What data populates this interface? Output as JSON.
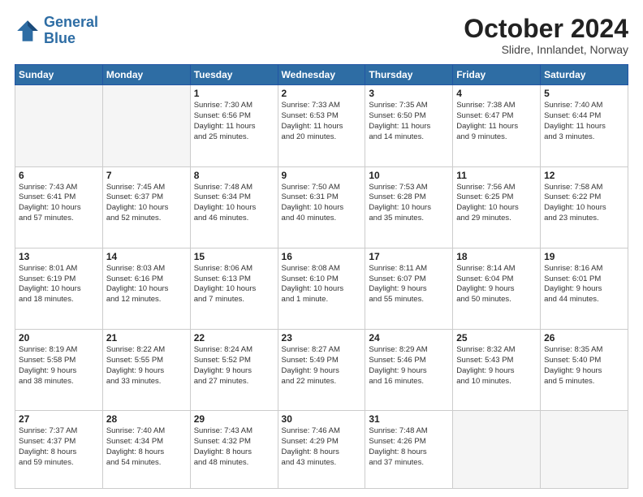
{
  "logo": {
    "line1": "General",
    "line2": "Blue"
  },
  "title": "October 2024",
  "subtitle": "Slidre, Innlandet, Norway",
  "headers": [
    "Sunday",
    "Monday",
    "Tuesday",
    "Wednesday",
    "Thursday",
    "Friday",
    "Saturday"
  ],
  "weeks": [
    [
      {
        "day": "",
        "detail": ""
      },
      {
        "day": "",
        "detail": ""
      },
      {
        "day": "1",
        "detail": "Sunrise: 7:30 AM\nSunset: 6:56 PM\nDaylight: 11 hours\nand 25 minutes."
      },
      {
        "day": "2",
        "detail": "Sunrise: 7:33 AM\nSunset: 6:53 PM\nDaylight: 11 hours\nand 20 minutes."
      },
      {
        "day": "3",
        "detail": "Sunrise: 7:35 AM\nSunset: 6:50 PM\nDaylight: 11 hours\nand 14 minutes."
      },
      {
        "day": "4",
        "detail": "Sunrise: 7:38 AM\nSunset: 6:47 PM\nDaylight: 11 hours\nand 9 minutes."
      },
      {
        "day": "5",
        "detail": "Sunrise: 7:40 AM\nSunset: 6:44 PM\nDaylight: 11 hours\nand 3 minutes."
      }
    ],
    [
      {
        "day": "6",
        "detail": "Sunrise: 7:43 AM\nSunset: 6:41 PM\nDaylight: 10 hours\nand 57 minutes."
      },
      {
        "day": "7",
        "detail": "Sunrise: 7:45 AM\nSunset: 6:37 PM\nDaylight: 10 hours\nand 52 minutes."
      },
      {
        "day": "8",
        "detail": "Sunrise: 7:48 AM\nSunset: 6:34 PM\nDaylight: 10 hours\nand 46 minutes."
      },
      {
        "day": "9",
        "detail": "Sunrise: 7:50 AM\nSunset: 6:31 PM\nDaylight: 10 hours\nand 40 minutes."
      },
      {
        "day": "10",
        "detail": "Sunrise: 7:53 AM\nSunset: 6:28 PM\nDaylight: 10 hours\nand 35 minutes."
      },
      {
        "day": "11",
        "detail": "Sunrise: 7:56 AM\nSunset: 6:25 PM\nDaylight: 10 hours\nand 29 minutes."
      },
      {
        "day": "12",
        "detail": "Sunrise: 7:58 AM\nSunset: 6:22 PM\nDaylight: 10 hours\nand 23 minutes."
      }
    ],
    [
      {
        "day": "13",
        "detail": "Sunrise: 8:01 AM\nSunset: 6:19 PM\nDaylight: 10 hours\nand 18 minutes."
      },
      {
        "day": "14",
        "detail": "Sunrise: 8:03 AM\nSunset: 6:16 PM\nDaylight: 10 hours\nand 12 minutes."
      },
      {
        "day": "15",
        "detail": "Sunrise: 8:06 AM\nSunset: 6:13 PM\nDaylight: 10 hours\nand 7 minutes."
      },
      {
        "day": "16",
        "detail": "Sunrise: 8:08 AM\nSunset: 6:10 PM\nDaylight: 10 hours\nand 1 minute."
      },
      {
        "day": "17",
        "detail": "Sunrise: 8:11 AM\nSunset: 6:07 PM\nDaylight: 9 hours\nand 55 minutes."
      },
      {
        "day": "18",
        "detail": "Sunrise: 8:14 AM\nSunset: 6:04 PM\nDaylight: 9 hours\nand 50 minutes."
      },
      {
        "day": "19",
        "detail": "Sunrise: 8:16 AM\nSunset: 6:01 PM\nDaylight: 9 hours\nand 44 minutes."
      }
    ],
    [
      {
        "day": "20",
        "detail": "Sunrise: 8:19 AM\nSunset: 5:58 PM\nDaylight: 9 hours\nand 38 minutes."
      },
      {
        "day": "21",
        "detail": "Sunrise: 8:22 AM\nSunset: 5:55 PM\nDaylight: 9 hours\nand 33 minutes."
      },
      {
        "day": "22",
        "detail": "Sunrise: 8:24 AM\nSunset: 5:52 PM\nDaylight: 9 hours\nand 27 minutes."
      },
      {
        "day": "23",
        "detail": "Sunrise: 8:27 AM\nSunset: 5:49 PM\nDaylight: 9 hours\nand 22 minutes."
      },
      {
        "day": "24",
        "detail": "Sunrise: 8:29 AM\nSunset: 5:46 PM\nDaylight: 9 hours\nand 16 minutes."
      },
      {
        "day": "25",
        "detail": "Sunrise: 8:32 AM\nSunset: 5:43 PM\nDaylight: 9 hours\nand 10 minutes."
      },
      {
        "day": "26",
        "detail": "Sunrise: 8:35 AM\nSunset: 5:40 PM\nDaylight: 9 hours\nand 5 minutes."
      }
    ],
    [
      {
        "day": "27",
        "detail": "Sunrise: 7:37 AM\nSunset: 4:37 PM\nDaylight: 8 hours\nand 59 minutes."
      },
      {
        "day": "28",
        "detail": "Sunrise: 7:40 AM\nSunset: 4:34 PM\nDaylight: 8 hours\nand 54 minutes."
      },
      {
        "day": "29",
        "detail": "Sunrise: 7:43 AM\nSunset: 4:32 PM\nDaylight: 8 hours\nand 48 minutes."
      },
      {
        "day": "30",
        "detail": "Sunrise: 7:46 AM\nSunset: 4:29 PM\nDaylight: 8 hours\nand 43 minutes."
      },
      {
        "day": "31",
        "detail": "Sunrise: 7:48 AM\nSunset: 4:26 PM\nDaylight: 8 hours\nand 37 minutes."
      },
      {
        "day": "",
        "detail": ""
      },
      {
        "day": "",
        "detail": ""
      }
    ]
  ]
}
